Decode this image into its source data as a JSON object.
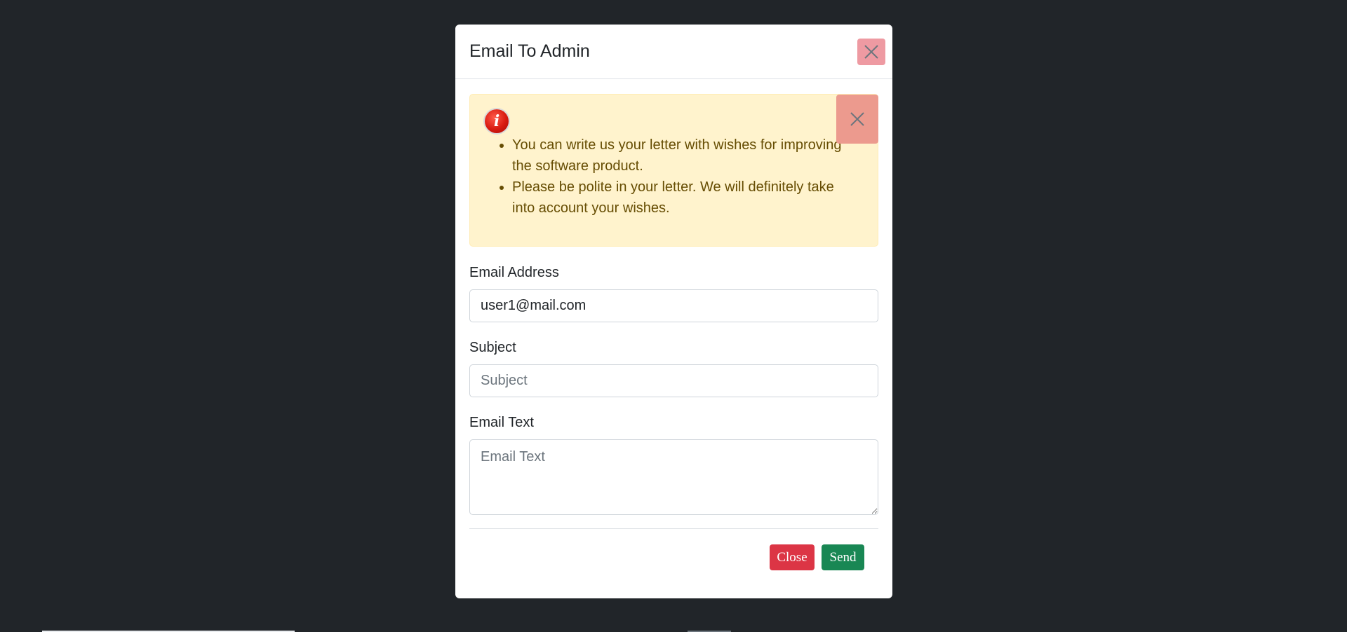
{
  "modal": {
    "title": "Email To Admin",
    "header_close_icon": "close-icon"
  },
  "alert": {
    "icon": "info-icon",
    "icon_glyph": "i",
    "items": [
      "You can write us your letter with wishes for improving the software product.",
      "Please be polite in your letter. We will definitely take into account your wishes."
    ],
    "close_icon": "close-icon"
  },
  "form": {
    "email": {
      "label": "Email Address",
      "value": "user1@mail.com"
    },
    "subject": {
      "label": "Subject",
      "value": "",
      "placeholder": "Subject"
    },
    "text": {
      "label": "Email Text",
      "value": "",
      "placeholder": "Email Text"
    }
  },
  "footer": {
    "close_label": "Close",
    "send_label": "Send"
  },
  "colors": {
    "backdrop": "#212529",
    "alert_bg": "#fff3cd",
    "close_button": "#dc3545",
    "send_button": "#198754"
  }
}
